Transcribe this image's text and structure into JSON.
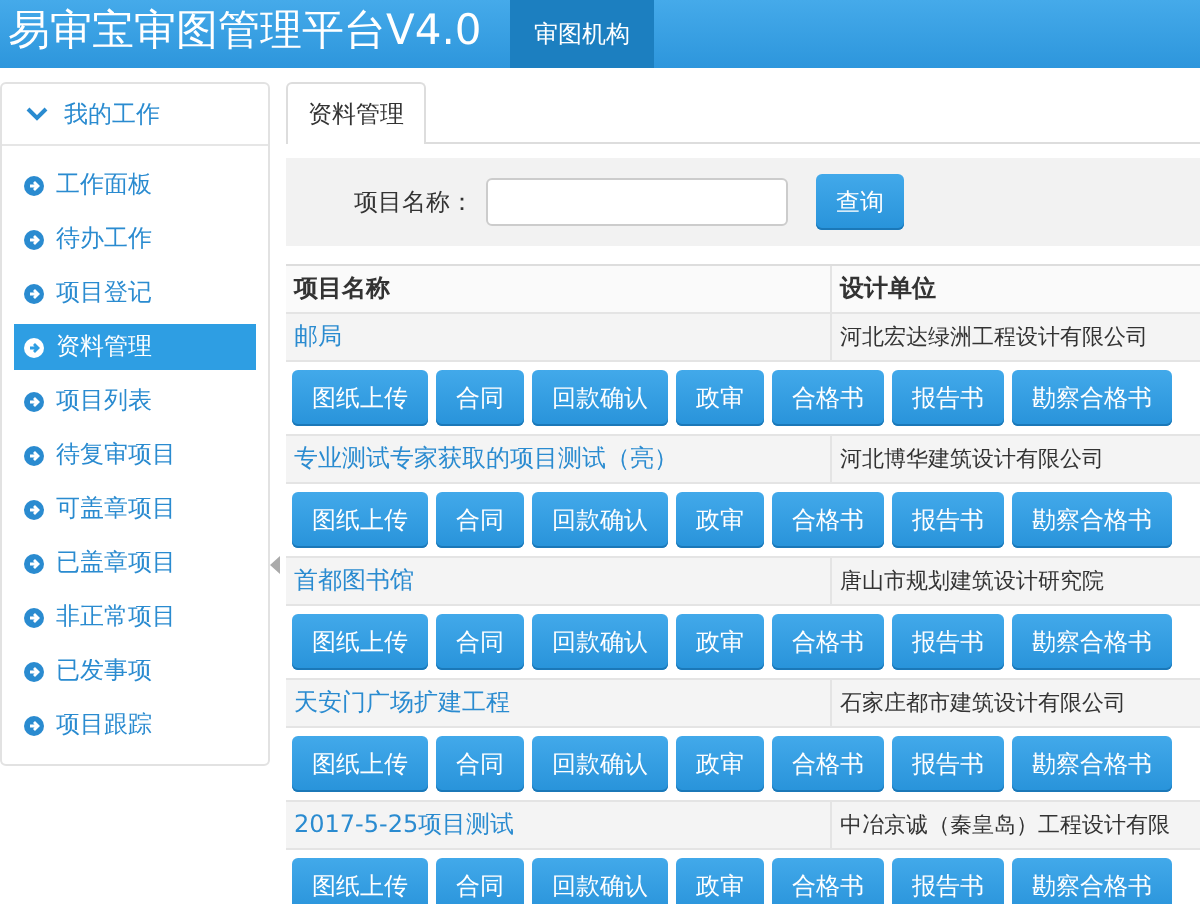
{
  "header": {
    "title": "易审宝审图管理平台V4.0",
    "nav": [
      {
        "label": "审图机构",
        "selected": true
      }
    ]
  },
  "sidebar": {
    "title": "我的工作",
    "expanded": true,
    "items": [
      {
        "label": "工作面板",
        "selected": false
      },
      {
        "label": "待办工作",
        "selected": false
      },
      {
        "label": "项目登记",
        "selected": false
      },
      {
        "label": "资料管理",
        "selected": true
      },
      {
        "label": "项目列表",
        "selected": false
      },
      {
        "label": "待复审项目",
        "selected": false
      },
      {
        "label": "可盖章项目",
        "selected": false
      },
      {
        "label": "已盖章项目",
        "selected": false
      },
      {
        "label": "非正常项目",
        "selected": false
      },
      {
        "label": "已发事项",
        "selected": false
      },
      {
        "label": "项目跟踪",
        "selected": false
      }
    ]
  },
  "tabs": [
    {
      "label": "资料管理",
      "selected": true
    }
  ],
  "search": {
    "label": "项目名称：",
    "button": "查询"
  },
  "table": {
    "columns": [
      "项目名称",
      "设计单位"
    ],
    "rows": [
      {
        "name": "邮局",
        "design_unit": "河北宏达绿洲工程设计有限公司",
        "actions": [
          "图纸上传",
          "合同",
          "回款确认",
          "政审",
          "合格书",
          "报告书",
          "勘察合格书"
        ]
      },
      {
        "name": "专业测试专家获取的项目测试（亮）",
        "design_unit": "河北博华建筑设计有限公司",
        "actions": [
          "图纸上传",
          "合同",
          "回款确认",
          "政审",
          "合格书",
          "报告书",
          "勘察合格书"
        ]
      },
      {
        "name": "首都图书馆",
        "design_unit": "唐山市规划建筑设计研究院",
        "actions": [
          "图纸上传",
          "合同",
          "回款确认",
          "政审",
          "合格书",
          "报告书",
          "勘察合格书"
        ]
      },
      {
        "name": "天安门广场扩建工程",
        "design_unit": "石家庄都市建筑设计有限公司",
        "actions": [
          "图纸上传",
          "合同",
          "回款确认",
          "政审",
          "合格书",
          "报告书",
          "勘察合格书"
        ]
      },
      {
        "name": "2017-5-25项目测试",
        "design_unit": "中冶京诚（秦皇岛）工程设计有限",
        "actions": [
          "图纸上传",
          "合同",
          "回款确认",
          "政审",
          "合格书",
          "报告书",
          "勘察合格书"
        ]
      }
    ]
  }
}
